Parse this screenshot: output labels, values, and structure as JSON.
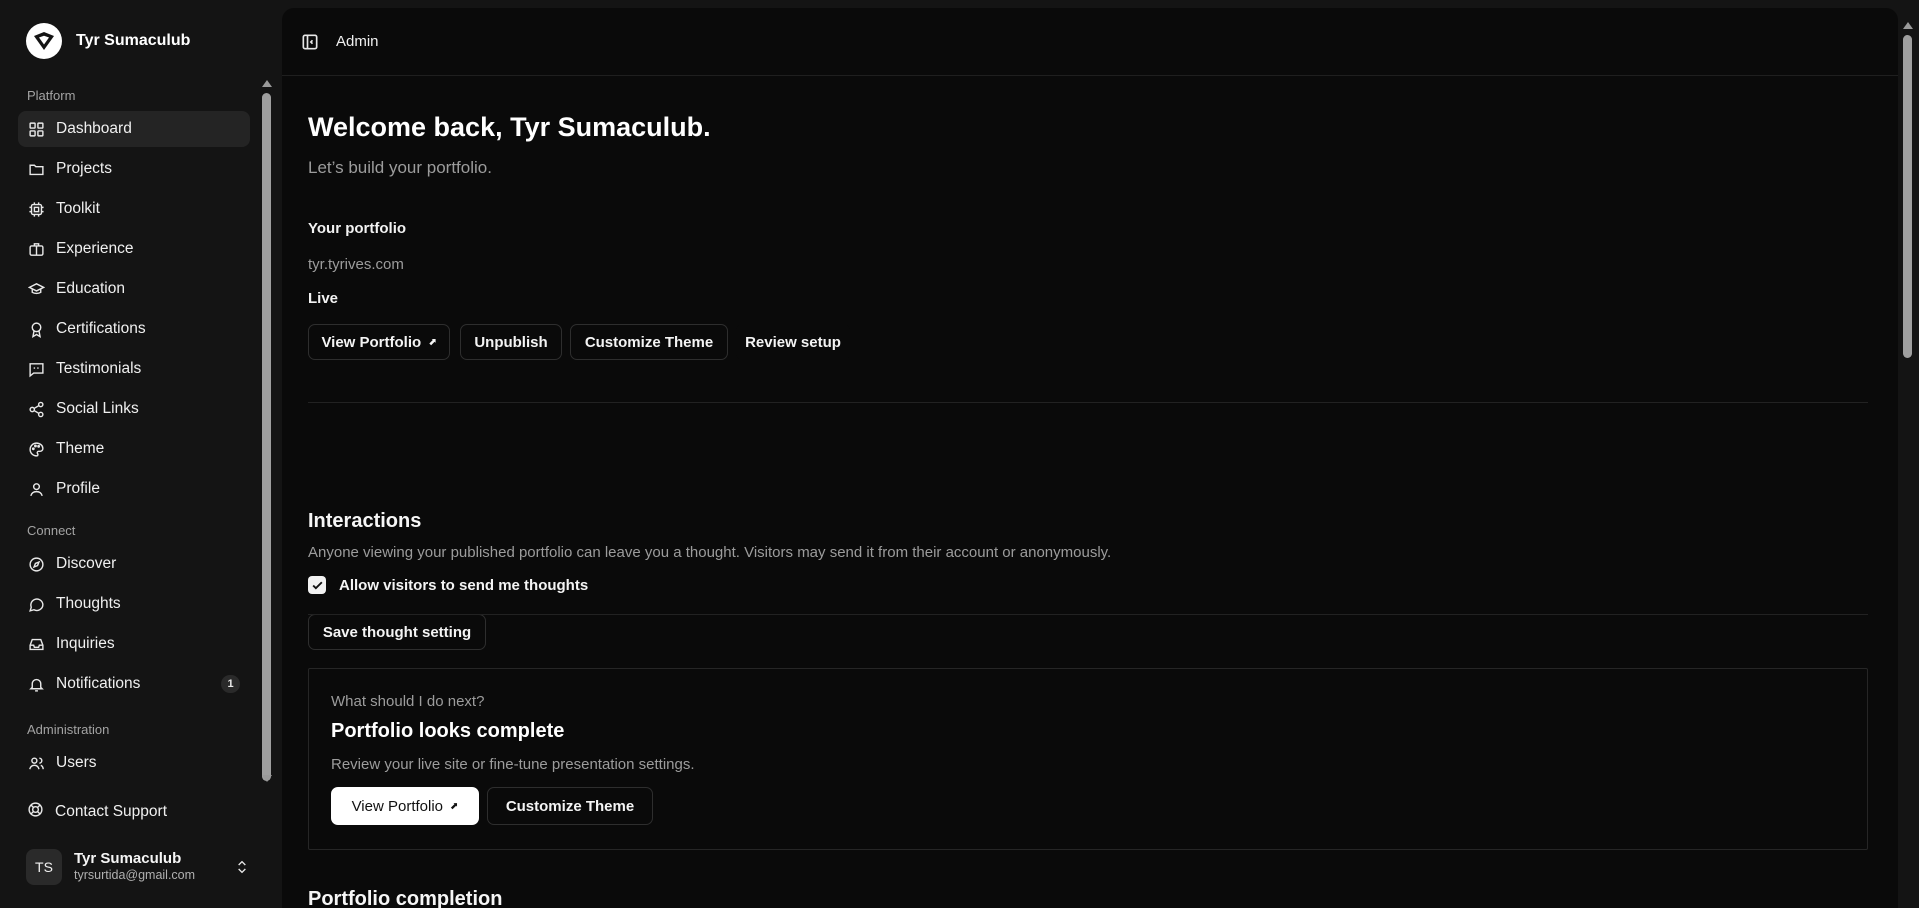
{
  "brand": {
    "name": "Tyr Sumaculub",
    "logo_icon": "heart-shield-logo"
  },
  "sidebar": {
    "sections": [
      {
        "label": "Platform"
      },
      {
        "label": "Connect"
      },
      {
        "label": "Administration"
      }
    ],
    "items": [
      {
        "label": "Dashboard",
        "icon": "grid-icon",
        "active": true
      },
      {
        "label": "Projects",
        "icon": "folder-icon"
      },
      {
        "label": "Toolkit",
        "icon": "chip-icon"
      },
      {
        "label": "Experience",
        "icon": "briefcase-icon"
      },
      {
        "label": "Education",
        "icon": "graduation-cap-icon"
      },
      {
        "label": "Certifications",
        "icon": "award-icon"
      },
      {
        "label": "Testimonials",
        "icon": "message-quote-icon"
      },
      {
        "label": "Social Links",
        "icon": "share-icon"
      },
      {
        "label": "Theme",
        "icon": "palette-icon"
      },
      {
        "label": "Profile",
        "icon": "user-icon"
      },
      {
        "label": "Discover",
        "icon": "compass-icon"
      },
      {
        "label": "Thoughts",
        "icon": "message-circle-icon"
      },
      {
        "label": "Inquiries",
        "icon": "inbox-icon"
      },
      {
        "label": "Notifications",
        "icon": "bell-icon",
        "badge": "1"
      },
      {
        "label": "Users",
        "icon": "users-icon"
      }
    ],
    "contact": {
      "label": "Contact Support",
      "icon": "lifebuoy-icon"
    },
    "user": {
      "initials": "TS",
      "name": "Tyr Sumaculub",
      "email": "tyrsurtida@gmail.com"
    }
  },
  "header": {
    "breadcrumb": "Admin"
  },
  "welcome": {
    "title": "Welcome back, Tyr Sumaculub.",
    "subtitle": "Let’s build your portfolio."
  },
  "portfolio": {
    "label": "Your portfolio",
    "url": "tyr.tyrives.com",
    "status": "Live",
    "buttons": {
      "view": "View Portfolio",
      "unpublish": "Unpublish",
      "customize": "Customize Theme",
      "review": "Review setup"
    }
  },
  "interactions": {
    "heading": "Interactions",
    "description": "Anyone viewing your published portfolio can leave you a thought. Visitors may send it from their account or anonymously.",
    "checkbox_label": "Allow visitors to send me thoughts",
    "checked": true,
    "save_label": "Save thought setting"
  },
  "next": {
    "question": "What should I do next?",
    "title": "Portfolio looks complete",
    "description": "Review your live site or fine-tune presentation settings.",
    "view_label": "View Portfolio",
    "customize_label": "Customize Theme"
  },
  "completion": {
    "heading": "Portfolio completion"
  },
  "colors": {
    "background": "#0a0a0a",
    "sidebar": "#141414",
    "accent": "#ffffff",
    "muted_text": "#9c9c9c"
  }
}
